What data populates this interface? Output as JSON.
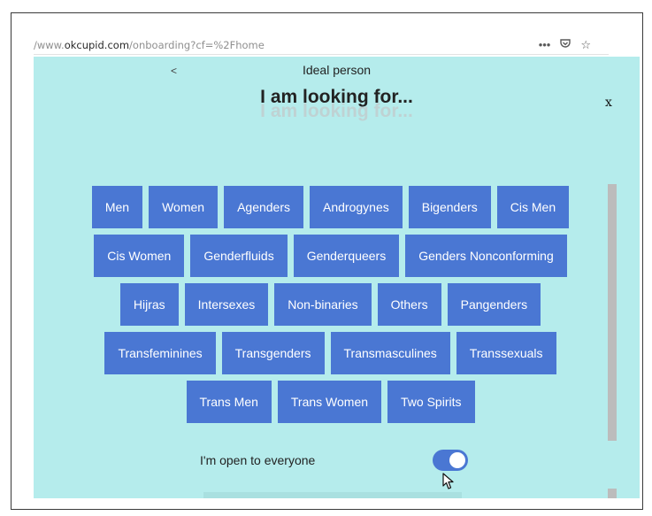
{
  "browser": {
    "url_prefix": "/www.",
    "url_domain": "okcupid.com",
    "url_path": "/onboarding?cf=%2Fhome",
    "icons": [
      "more-dots-icon",
      "pocket-icon",
      "bookmark-star-icon"
    ]
  },
  "header": {
    "back_label": "<",
    "step_label": "Ideal person",
    "title": "I am looking for...",
    "close_label": "x"
  },
  "options": {
    "rows": [
      [
        "Men",
        "Women",
        "Agenders",
        "Androgynes",
        "Bigenders",
        "Cis Men"
      ],
      [
        "Cis Women",
        "Genderfluids",
        "Genderqueers",
        "Genders Nonconforming"
      ],
      [
        "Hijras",
        "Intersexes",
        "Non-binaries",
        "Others",
        "Pangenders"
      ],
      [
        "Transfeminines",
        "Transgenders",
        "Transmasculines",
        "Transsexuals"
      ],
      [
        "Trans Men",
        "Trans Women",
        "Two Spirits"
      ]
    ]
  },
  "open_toggle": {
    "label": "I'm open to everyone",
    "state": "on"
  },
  "colors": {
    "accent": "#4a77d3",
    "background": "#b5ecec"
  }
}
